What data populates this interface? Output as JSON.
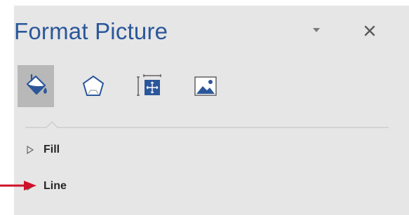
{
  "pane": {
    "title": "Format Picture"
  },
  "tabs": [
    {
      "id": "fill-line",
      "icon": "paint-bucket-icon",
      "active": true
    },
    {
      "id": "effects",
      "icon": "pentagon-icon",
      "active": false
    },
    {
      "id": "size-properties",
      "icon": "size-layout-icon",
      "active": false
    },
    {
      "id": "picture",
      "icon": "picture-icon",
      "active": false
    }
  ],
  "sections": {
    "fill": {
      "label": "Fill"
    },
    "line": {
      "label": "Line"
    }
  },
  "colors": {
    "title": "#2b579a",
    "pane_background": "#e6e6e6",
    "active_tab": "#b8b8b8",
    "callout_arrow": "#d0102a"
  }
}
